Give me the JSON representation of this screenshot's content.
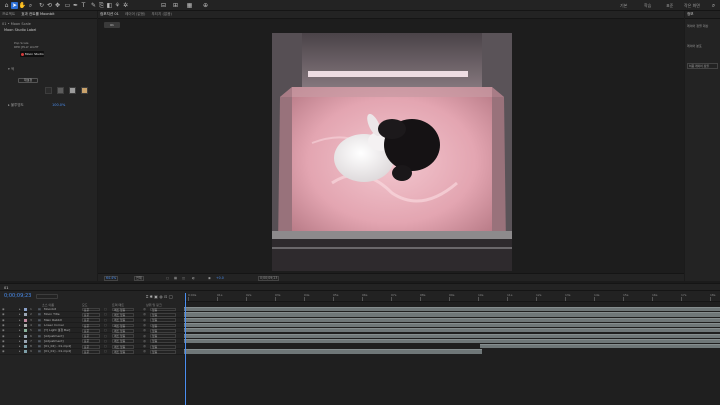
{
  "toolbar": {
    "icons": [
      "home-icon",
      "selection-icon",
      "hand-icon",
      "zoom-icon",
      "rotate-icon",
      "orbit-icon",
      "pan-behind-icon",
      "rectangle-icon",
      "pen-icon",
      "type-icon",
      "brush-icon",
      "clone-icon",
      "eraser-icon",
      "roto-icon",
      "puppet-icon"
    ],
    "workspaces": [
      "기본",
      "학습",
      "표준",
      "작은 화면",
      "라이브러리"
    ]
  },
  "left_panel": {
    "tab_project": "프로젝트",
    "tab_effect_controls": "효과 컨트롤 Moonbit",
    "breadcrumb": "01 • Moon Scale",
    "layer_line": "Moon Studio Label",
    "sub1": "Pop Scale",
    "sub2": "RED JELLY LIGHT",
    "brand_label": "Moon Studio",
    "section_color": "색",
    "reset_label": "재설정",
    "section_opacity": "불투명도",
    "opacity_value": "100.0%"
  },
  "viewer": {
    "tabs": [
      "컴포지션 01",
      "레이어 (없음)",
      "푸티지 (없음)"
    ],
    "active_comp_chip": "01",
    "status": {
      "zoom": "64.4%",
      "resolution": "전체",
      "exposure": "+0.0",
      "timecode": "0;00;09;23"
    }
  },
  "right_panel": {
    "tab": "정보",
    "line1": "레이어 정렬 대상",
    "line2": "레이어 분포",
    "line3": "허용 레이어 정렬"
  },
  "timeline": {
    "tab_label": "01",
    "timecode": "0;00;09;23",
    "columns": {
      "source_name": "소스 이름",
      "mode": "모드",
      "trkmat": "트랙 매트",
      "parent": "상위 및 링크"
    },
    "ruler_labels": [
      "0:00s",
      "01s",
      "02s",
      "03s",
      "04s",
      "05s",
      "06s",
      "07s",
      "08s",
      "09s",
      "10s",
      "11s",
      "12s",
      "13s",
      "14s",
      "15s",
      "16s",
      "17s",
      "18s"
    ],
    "layers": [
      {
        "num": "1",
        "name": "Moonbit",
        "mode": "표준",
        "trkmat": "매트 없음",
        "parent": "없음",
        "color": "#8aa1c9"
      },
      {
        "num": "2",
        "name": "Moon Title",
        "mode": "표준",
        "trkmat": "매트 없음",
        "parent": "없음",
        "color": "#9ba7b6"
      },
      {
        "num": "3",
        "name": "Main Rabbit",
        "mode": "표준",
        "trkmat": "매트 없음",
        "parent": "없음",
        "color": "#c28aa1"
      },
      {
        "num": "4",
        "name": "Lower Corner",
        "mode": "표준",
        "trkmat": "매트 없음",
        "parent": "없음",
        "color": "#aaaaaa"
      },
      {
        "num": "5",
        "name": "[Y] Light 설정 Bar]",
        "mode": "표준",
        "trkmat": "매트 없음",
        "parent": "없음",
        "color": "#8ab39b"
      },
      {
        "num": "6",
        "name": "[Adjustment]",
        "mode": "표준",
        "trkmat": "매트 없음",
        "parent": "없음",
        "color": "#9aa6b3"
      },
      {
        "num": "7",
        "name": "[Adjustment]",
        "mode": "표준",
        "trkmat": "매트 없음",
        "parent": "없음",
        "color": "#9aa6b3"
      },
      {
        "num": "8",
        "name": "[01_02] - 01.mp4]",
        "mode": "표준",
        "trkmat": "매트 없음",
        "parent": "없음",
        "color": "#7e9fa8"
      },
      {
        "num": "9",
        "name": "[01_01] - 01.mp4]",
        "mode": "표준",
        "trkmat": "매트 없음",
        "parent": "없음",
        "color": "#7e9fa8"
      }
    ]
  }
}
